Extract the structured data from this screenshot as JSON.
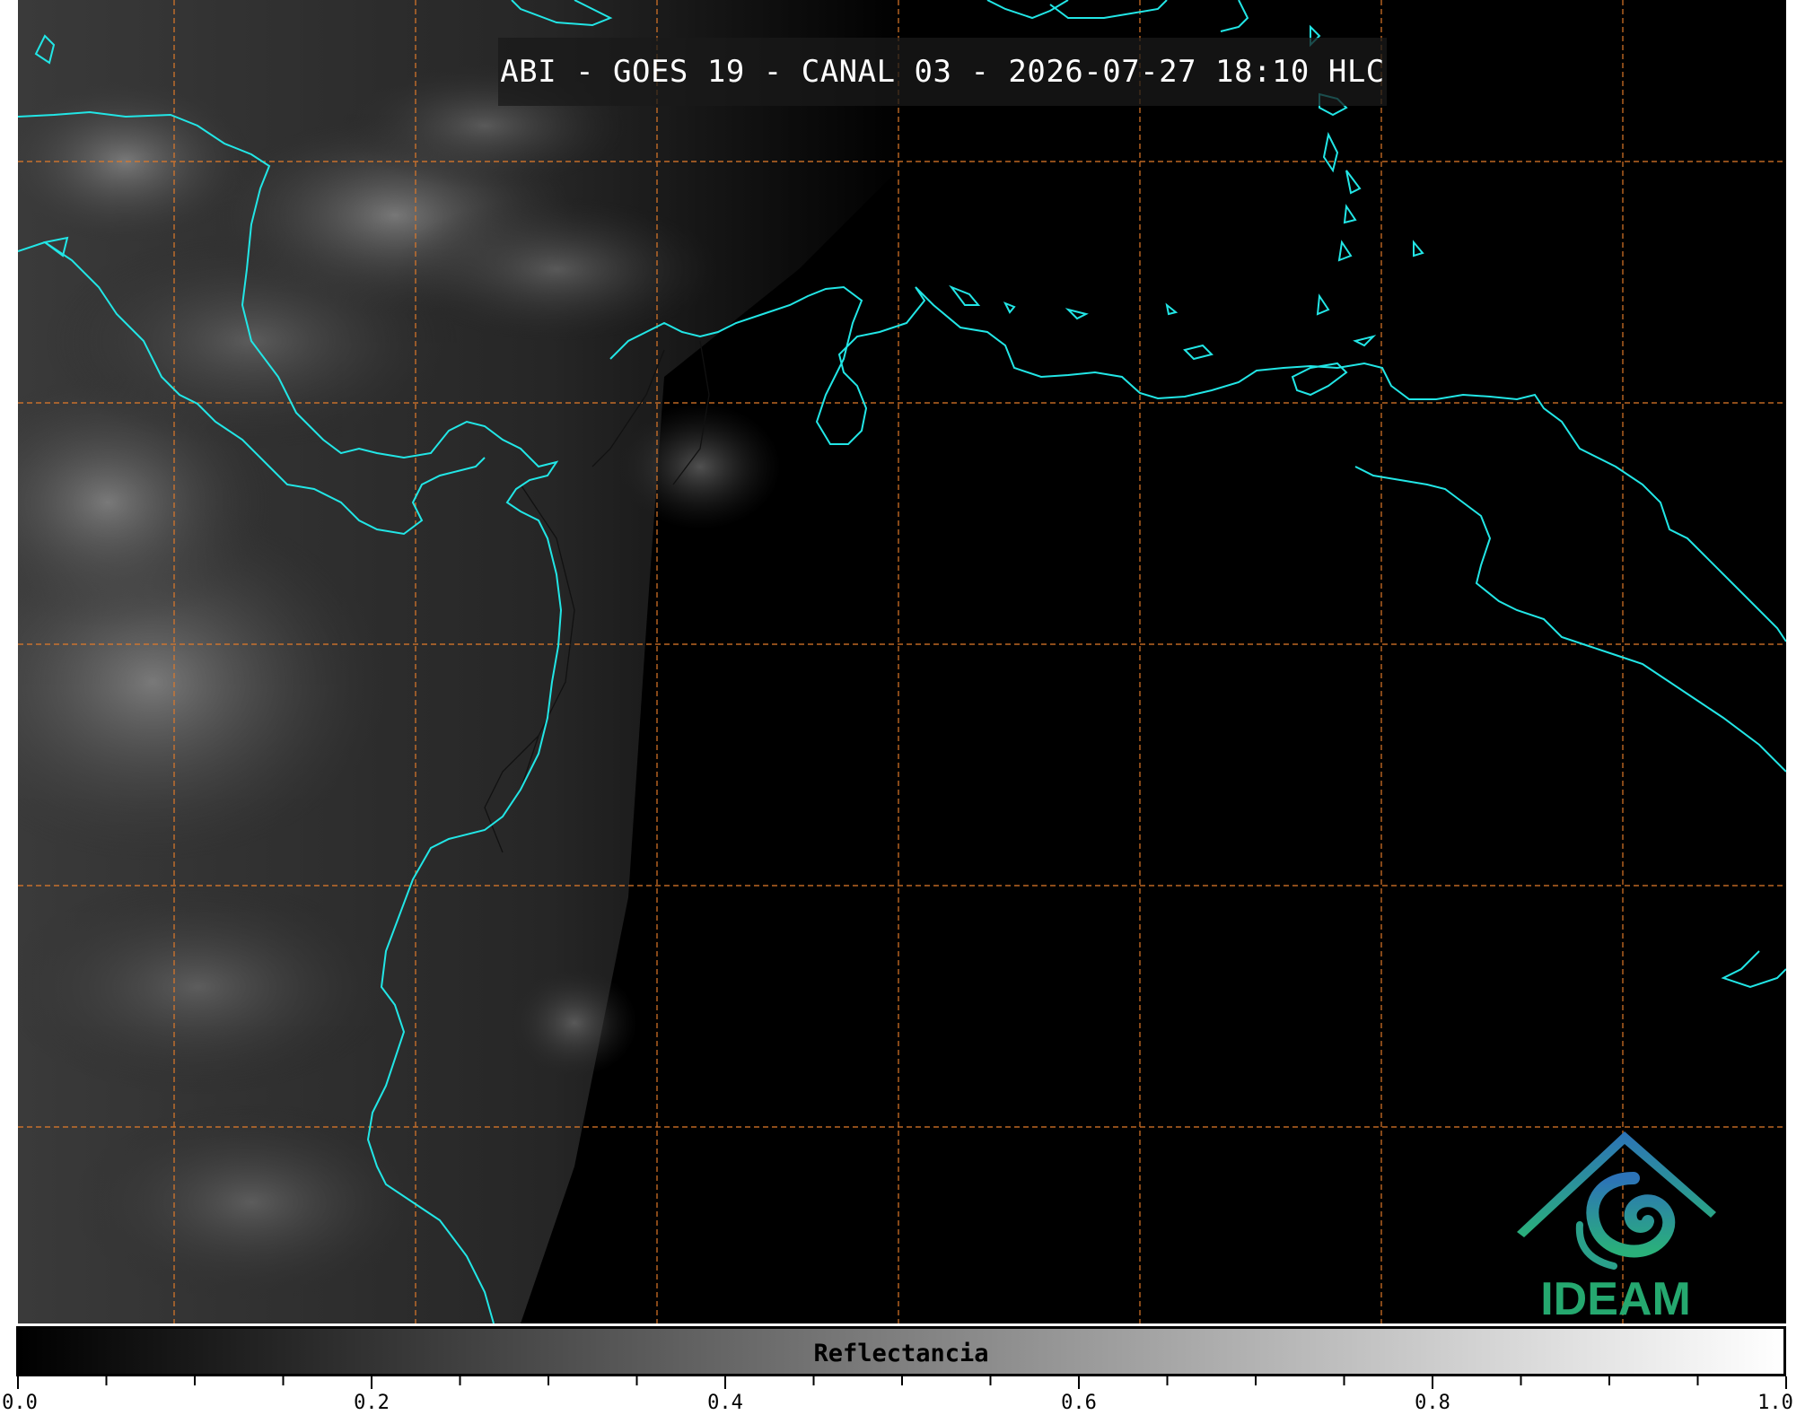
{
  "title": "ABI - GOES 19 - CANAL 03 - 2026-07-27 18:10 HLC",
  "colors": {
    "coastline": "#22e6e6",
    "gridline": "#e07a2a",
    "border": "#111111",
    "background": "#000000"
  },
  "colorbar": {
    "label": "Reflectancia",
    "min": 0.0,
    "max": 1.0,
    "tick_labels": [
      "0.0",
      "0.2",
      "0.4",
      "0.6",
      "0.8",
      "1.0"
    ],
    "colormap": "grayscale"
  },
  "logo": {
    "text": "IDEAM",
    "icon": "ideam-swirl-icon"
  }
}
